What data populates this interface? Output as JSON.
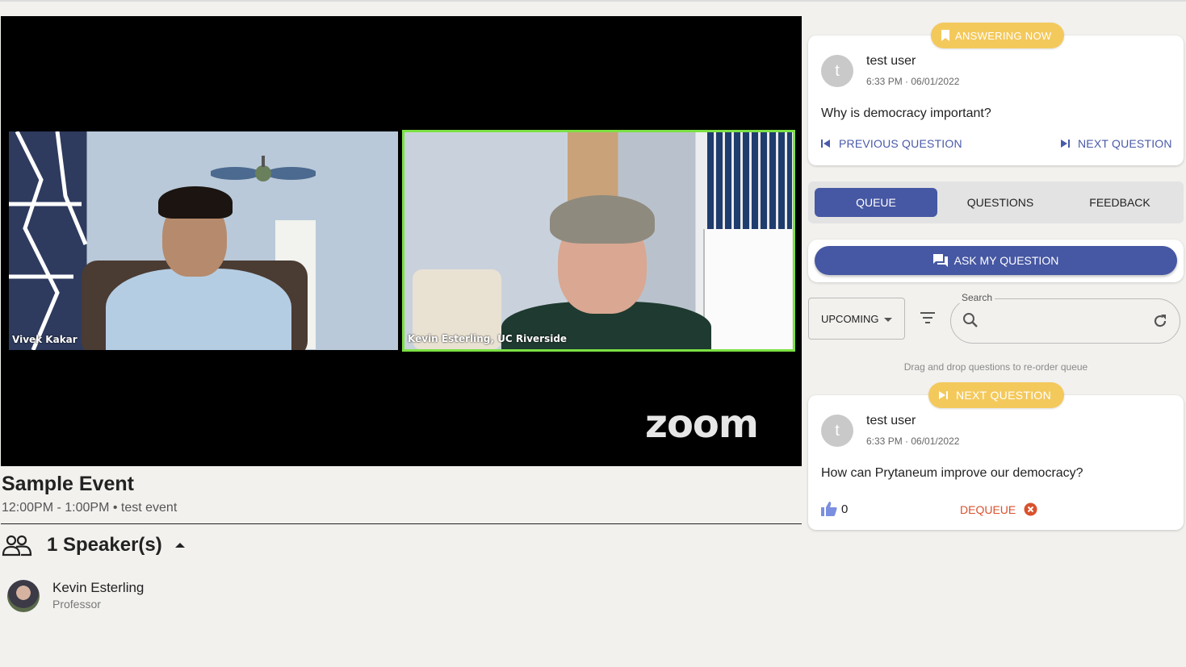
{
  "video": {
    "left_participant": "Vivek Kakar",
    "right_participant": "Kevin Esterling, UC Riverside",
    "logo": "zoom"
  },
  "event": {
    "title": "Sample Event",
    "subtitle": "12:00PM - 1:00PM • test event",
    "speakers_label": "1 Speaker(s)",
    "speakers": [
      {
        "name": "Kevin Esterling",
        "role": "Professor"
      }
    ]
  },
  "current_question": {
    "badge": "ANSWERING NOW",
    "avatar_letter": "t",
    "user": "test user",
    "time": "6:33 PM · 06/01/2022",
    "text": "Why is democracy important?",
    "prev_label": "PREVIOUS QUESTION",
    "next_label": "NEXT QUESTION"
  },
  "tabs": [
    {
      "label": "QUEUE",
      "active": true
    },
    {
      "label": "QUESTIONS",
      "active": false
    },
    {
      "label": "FEEDBACK",
      "active": false
    }
  ],
  "ask_button": "ASK MY QUESTION",
  "filter": {
    "select_value": "UPCOMING",
    "search_label": "Search",
    "search_value": "",
    "hint": "Drag and drop questions to re-order queue"
  },
  "queue_item": {
    "badge": "NEXT QUESTION",
    "avatar_letter": "t",
    "user": "test user",
    "time": "6:33 PM · 06/01/2022",
    "text": "How can Prytaneum improve our democracy?",
    "likes": "0",
    "dequeue_label": "DEQUEUE"
  },
  "colors": {
    "accent": "#4657a3",
    "badge_yellow": "#f4c95c",
    "danger": "#d9512c",
    "active_speaker_border": "#7ce043"
  }
}
